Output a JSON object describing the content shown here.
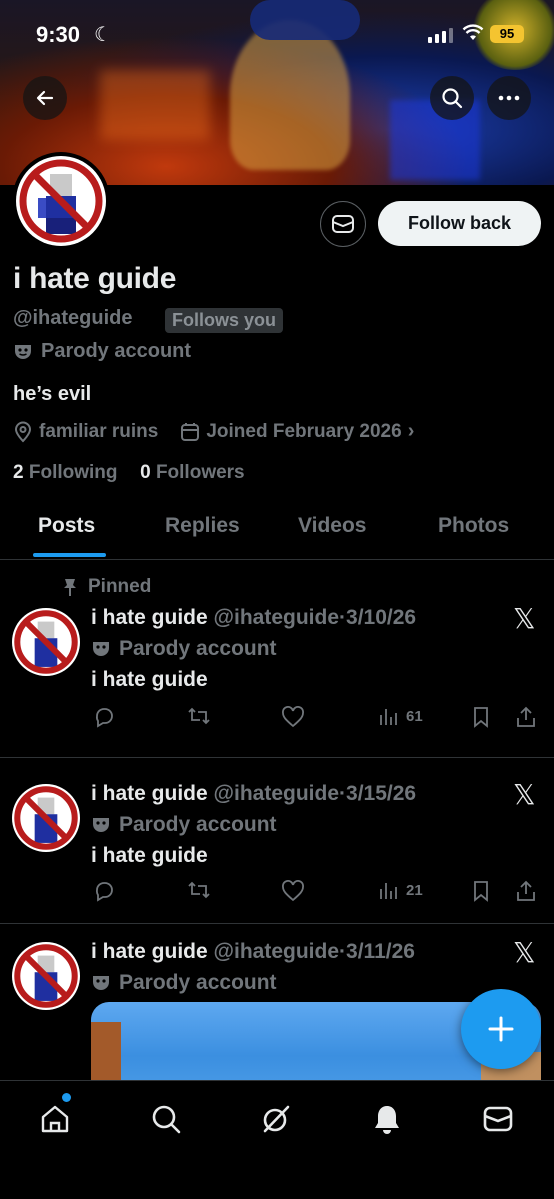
{
  "status_bar": {
    "time": "9:30",
    "battery": "95"
  },
  "profile": {
    "display_name": "i hate guide",
    "handle": "@ihateguide",
    "follows_you": "Follows you",
    "parody_label": "Parody account",
    "bio": "he’s evil",
    "location": "familiar ruins",
    "joined": "Joined February 2026",
    "following_count": "2",
    "following_label": "Following",
    "followers_count": "0",
    "followers_label": "Followers",
    "follow_button": "Follow back"
  },
  "tabs": [
    "Posts",
    "Replies",
    "Videos",
    "Photos"
  ],
  "pinned_label": "Pinned",
  "posts": [
    {
      "name": "i hate guide",
      "handle": "@ihateguide",
      "sep": "·",
      "date": "3/10/26",
      "parody": "Parody account",
      "text": "i hate guide",
      "views": "61"
    },
    {
      "name": "i hate guide",
      "handle": "@ihateguide",
      "sep": "·",
      "date": "3/15/26",
      "parody": "Parody account",
      "text": "i hate guide",
      "views": "21"
    },
    {
      "name": "i hate guide",
      "handle": "@ihateguide",
      "sep": "·",
      "date": "3/11/26",
      "parody": "Parody account",
      "text": "",
      "views": ""
    }
  ],
  "colors": {
    "accent": "#1d9bf0",
    "muted": "#71767b",
    "text": "#e7e9ea",
    "battery": "#f4c430"
  },
  "icons": [
    "back-arrow-icon",
    "search-icon",
    "more-icon",
    "mail-icon",
    "location-icon",
    "calendar-icon",
    "pin-icon",
    "reply-icon",
    "repost-icon",
    "like-icon",
    "views-icon",
    "bookmark-icon",
    "share-icon",
    "x-logo-icon",
    "compose-icon",
    "home-icon",
    "grok-icon",
    "bell-icon"
  ]
}
